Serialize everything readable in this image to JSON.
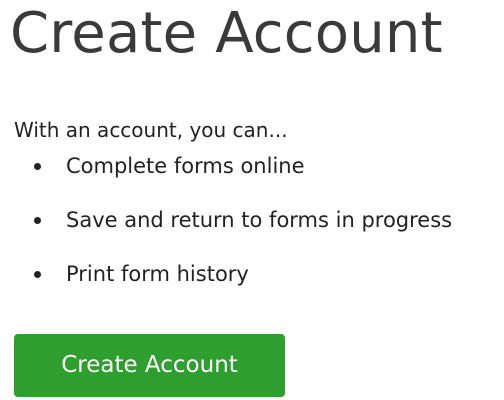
{
  "page": {
    "title": "Create Account"
  },
  "intro": {
    "text": "With an account, you can..."
  },
  "benefits": [
    {
      "text": "Complete forms online"
    },
    {
      "text": "Save and return to forms in progress"
    },
    {
      "text": "Print form history"
    }
  ],
  "actions": {
    "create_account_label": "Create Account"
  },
  "colors": {
    "button_background": "#2e9e2e",
    "button_text": "#ffffff",
    "title_text": "#3a3a3a",
    "body_text": "#222222"
  }
}
